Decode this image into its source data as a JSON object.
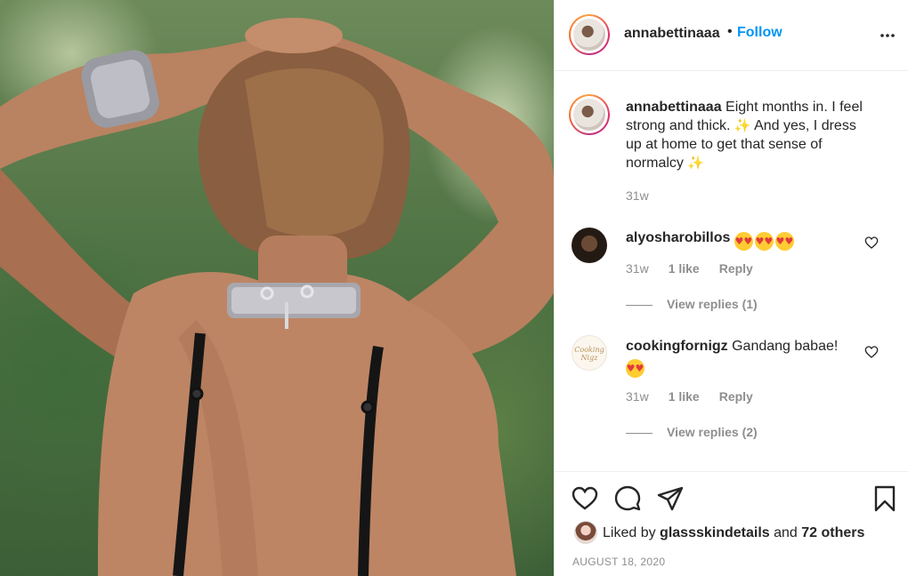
{
  "post": {
    "author": "annabettinaaa",
    "follow_label": "Follow",
    "separator": "•"
  },
  "caption": {
    "username": "annabettinaaa",
    "text_1": " Eight months in. I feel strong and thick. ",
    "text_2": " And yes, I dress up at home to get that sense of normalcy ",
    "emoji_sparkles": "✨",
    "time": "31w"
  },
  "comments": [
    {
      "username": "alyosharobillos",
      "text": "",
      "emoji": [
        "😍",
        "😍",
        "😍"
      ],
      "time": "31w",
      "likes": "1 like",
      "reply_label": "Reply",
      "view_replies": "View replies (1)"
    },
    {
      "username": "cookingfornigz",
      "text": " Gandang babae!",
      "emoji": [
        "😍"
      ],
      "time": "31w",
      "likes": "1 like",
      "reply_label": "Reply",
      "view_replies": "View replies (2)"
    }
  ],
  "likes": {
    "prefix": "Liked by ",
    "user": "glassskindetails",
    "middle": " and ",
    "others": "72 others"
  },
  "date": "AUGUST 18, 2020",
  "icons": {
    "more": "more-horizontal-icon",
    "like": "heart-icon",
    "comment": "comment-icon",
    "share": "share-icon",
    "save": "bookmark-icon"
  },
  "colors": {
    "follow": "#0095f6",
    "muted": "#8e8e8e",
    "text": "#262626"
  }
}
